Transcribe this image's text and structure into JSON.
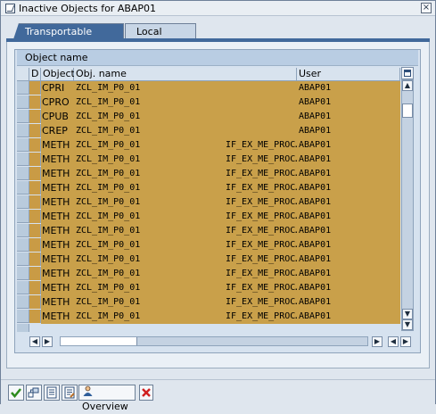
{
  "window": {
    "title": "Inactive Objects for ABAP01",
    "close_glyph": "×"
  },
  "tabs": [
    {
      "label": "Transportable Objects",
      "active": true
    },
    {
      "label": "Local objects",
      "active": false
    }
  ],
  "table": {
    "title": "Object name",
    "columns": [
      "D",
      "Object",
      "Obj. name",
      "",
      "User"
    ],
    "rows": [
      {
        "object": "CPRI",
        "obj_name": "ZCL_IM_P0_01",
        "sub": "",
        "user": "ABAP01"
      },
      {
        "object": "CPRO",
        "obj_name": "ZCL_IM_P0_01",
        "sub": "",
        "user": "ABAP01"
      },
      {
        "object": "CPUB",
        "obj_name": "ZCL_IM_P0_01",
        "sub": "",
        "user": "ABAP01"
      },
      {
        "object": "CREP",
        "obj_name": "ZCL_IM_P0_01",
        "sub": "",
        "user": "ABAP01"
      },
      {
        "object": "METH",
        "obj_name": "ZCL_IM_P0_01",
        "sub": "IF_EX_ME_PROC…",
        "user": "ABAP01"
      },
      {
        "object": "METH",
        "obj_name": "ZCL_IM_P0_01",
        "sub": "IF_EX_ME_PROC…",
        "user": "ABAP01"
      },
      {
        "object": "METH",
        "obj_name": "ZCL_IM_P0_01",
        "sub": "IF_EX_ME_PROC…",
        "user": "ABAP01"
      },
      {
        "object": "METH",
        "obj_name": "ZCL_IM_P0_01",
        "sub": "IF_EX_ME_PROC…",
        "user": "ABAP01"
      },
      {
        "object": "METH",
        "obj_name": "ZCL_IM_P0_01",
        "sub": "IF_EX_ME_PROC…",
        "user": "ABAP01"
      },
      {
        "object": "METH",
        "obj_name": "ZCL_IM_P0_01",
        "sub": "IF_EX_ME_PROC…",
        "user": "ABAP01"
      },
      {
        "object": "METH",
        "obj_name": "ZCL_IM_P0_01",
        "sub": "IF_EX_ME_PROC…",
        "user": "ABAP01"
      },
      {
        "object": "METH",
        "obj_name": "ZCL_IM_P0_01",
        "sub": "IF_EX_ME_PROC…",
        "user": "ABAP01"
      },
      {
        "object": "METH",
        "obj_name": "ZCL_IM_P0_01",
        "sub": "IF_EX_ME_PROC…",
        "user": "ABAP01"
      },
      {
        "object": "METH",
        "obj_name": "ZCL_IM_P0_01",
        "sub": "IF_EX_ME_PROC…",
        "user": "ABAP01"
      },
      {
        "object": "METH",
        "obj_name": "ZCL_IM_P0_01",
        "sub": "IF_EX_ME_PROC…",
        "user": "ABAP01"
      },
      {
        "object": "METH",
        "obj_name": "ZCL_IM_P0_01",
        "sub": "IF_EX_ME_PROC…",
        "user": "ABAP01"
      },
      {
        "object": "METH",
        "obj_name": "ZCL_IM_P0_01",
        "sub": "IF_EX_ME_PROC…",
        "user": "ABAP01"
      }
    ],
    "row_color": "#c9a04a"
  },
  "scroll": {
    "up": "▲",
    "down": "▼",
    "left": "◀",
    "right": "▶"
  },
  "toolbar": {
    "overview_label": "Overview",
    "icons": [
      "check-icon",
      "object-tree-icon",
      "display-icon",
      "display-change-icon",
      "overview-icon",
      "cancel-icon"
    ]
  },
  "colors": {
    "accent": "#41699b",
    "row": "#c9a04a",
    "cancel": "#d02020"
  }
}
